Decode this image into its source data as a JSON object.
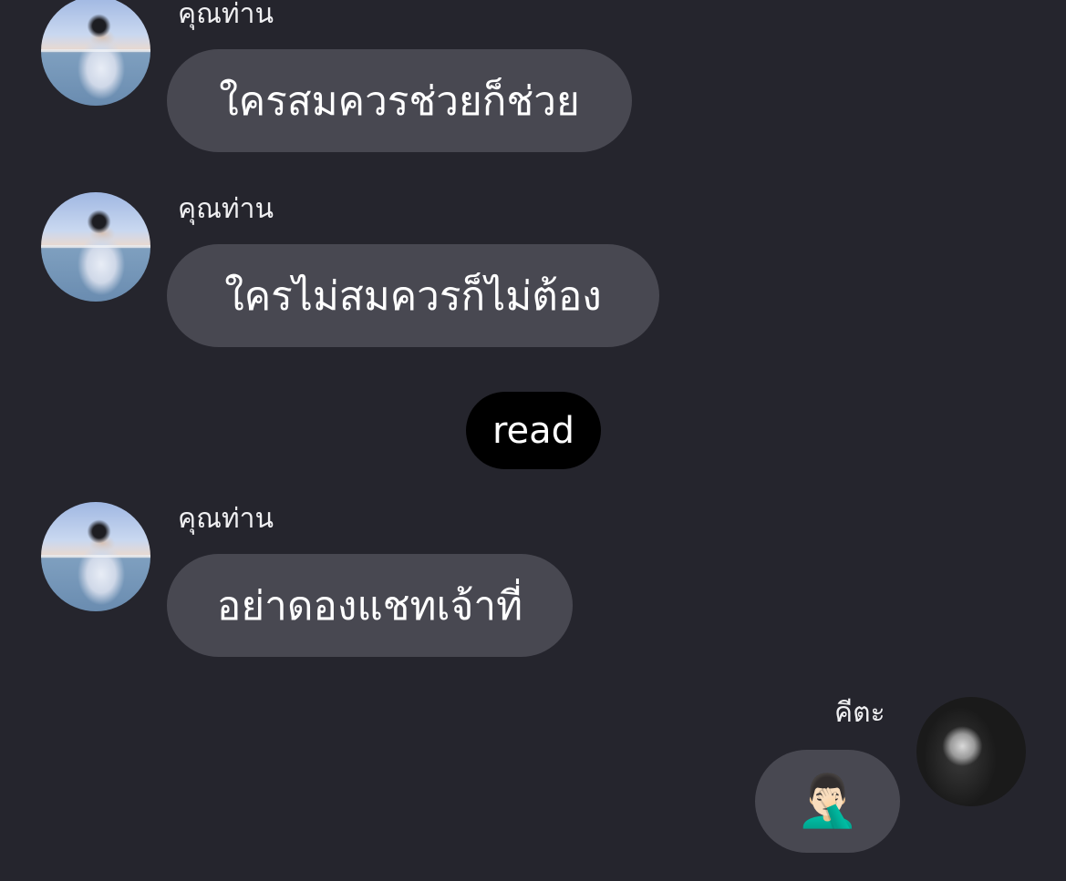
{
  "messages": [
    {
      "sender": "คุณท่าน",
      "text": "ใครสมควรช่วยก็ช่วย",
      "avatar_icon": "profile-photo-beach"
    },
    {
      "sender": "คุณท่าน",
      "text": "ใครไม่สมควรก็ไม่ต้อง",
      "avatar_icon": "profile-photo-beach"
    },
    {
      "sender": "คุณท่าน",
      "text": "อย่าดองแชทเจ้าที่",
      "avatar_icon": "profile-photo-beach"
    },
    {
      "sender": "คีตะ",
      "text": "🤦🏻‍♂️",
      "avatar_icon": "profile-photo-hoodie"
    }
  ],
  "read_indicator": "read",
  "colors": {
    "background": "#25252d",
    "bubble": "#484851",
    "read_pill": "#000000",
    "text": "#ffffff"
  }
}
